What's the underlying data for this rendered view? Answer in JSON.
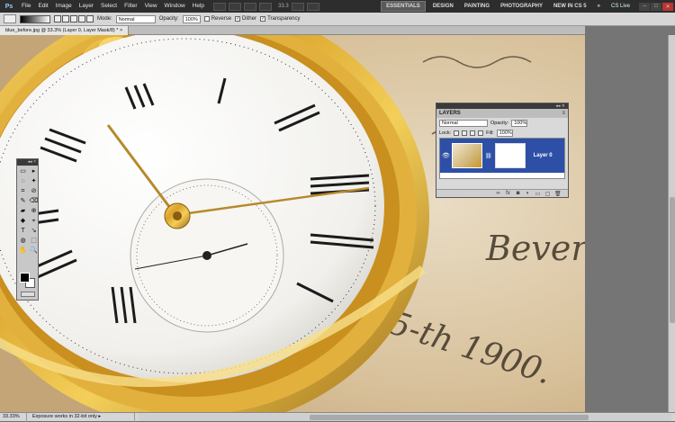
{
  "menubar": {
    "logo": "Ps",
    "items": [
      "File",
      "Edit",
      "Image",
      "Layer",
      "Select",
      "Filter",
      "View",
      "Window",
      "Help"
    ],
    "zoom": "33.3",
    "workspaces": [
      "ESSENTIALS",
      "DESIGN",
      "PAINTING",
      "PHOTOGRAPHY",
      "NEW IN CS 5"
    ],
    "more": "»",
    "cs_live": "CS Live",
    "window_buttons": [
      "–",
      "□",
      "✕"
    ]
  },
  "options": {
    "mode_label": "Mode:",
    "mode_value": "Normal",
    "opacity_label": "Opacity:",
    "opacity_value": "100%",
    "reverse": "Reverse",
    "dither": "Dither",
    "transparency": "Transparency"
  },
  "document": {
    "tab_title": "blue_before.jpg @ 33.3% (Layer 0, Layer Mask/8) *",
    "tab_close": "×"
  },
  "canvas": {
    "text_line1": "Bever",
    "text_line2": "5-th 1900."
  },
  "status": {
    "zoom": "33.33%",
    "message": "Exposure works in 32-bit only",
    "arrow": "▸"
  },
  "layers_panel": {
    "title": "LAYERS",
    "menu": "≡",
    "collapse": "◂◂ ✕",
    "blend_mode": "Normal",
    "opacity_label": "Opacity:",
    "opacity_value": "100%",
    "lock_label": "Lock:",
    "fill_label": "Fill:",
    "fill_value": "100%",
    "layer_name": "Layer 0"
  },
  "tools": {
    "header": "◂◂ ×",
    "icons": [
      "▭",
      "▸",
      "◌",
      "✦",
      "⌗",
      "⊘",
      "✎",
      "⌫",
      "▰",
      "⊕",
      "◆",
      "⌖",
      "T",
      "↘",
      "◍",
      "⬚",
      "✋",
      "🔍"
    ]
  },
  "colors": {
    "accent_layer": "#2e4fa6",
    "menubar": "#2d2d2d",
    "options_bar": "#d6d6d6"
  }
}
